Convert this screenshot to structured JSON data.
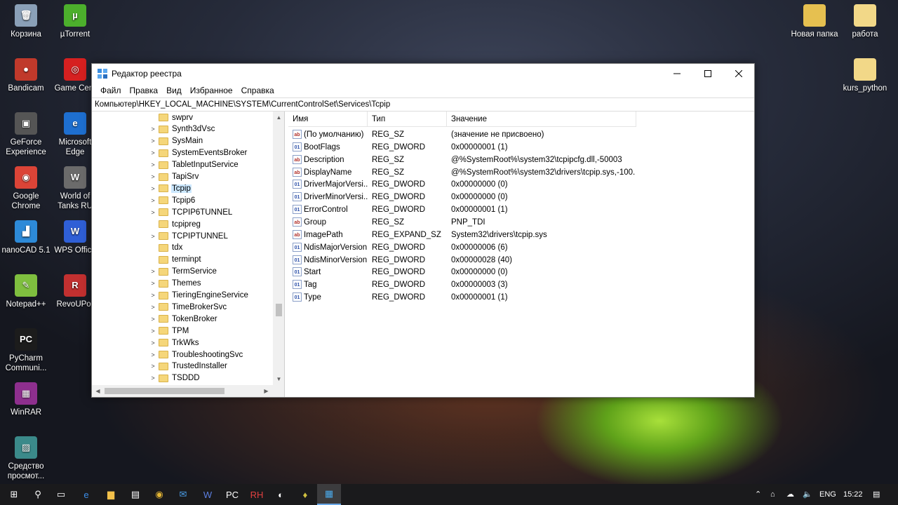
{
  "desktop_left": [
    {
      "label": "Корзина",
      "icon": "recycle-bin-icon",
      "color": "#8aa0b8",
      "glyph": "🗑"
    },
    {
      "label": "µTorrent",
      "icon": "utorrent-icon",
      "color": "#4caf2c",
      "glyph": "µ"
    },
    {
      "label": "Bandicam",
      "icon": "bandicam-icon",
      "color": "#c0392b",
      "glyph": "●"
    },
    {
      "label": "Game Cent",
      "icon": "game-center-icon",
      "color": "#d62020",
      "glyph": "◎"
    },
    {
      "label": "GeForce Experience",
      "icon": "geforce-icon",
      "color": "#555555",
      "glyph": "▣"
    },
    {
      "label": "Microsoft Edge",
      "icon": "edge-icon",
      "color": "#1e6fd0",
      "glyph": "e"
    },
    {
      "label": "Google Chrome",
      "icon": "chrome-icon",
      "color": "#db4437",
      "glyph": "◉"
    },
    {
      "label": "World of Tanks RU",
      "icon": "wot-icon",
      "color": "#6b6b6b",
      "glyph": "W"
    },
    {
      "label": "nanoCAD 5.1",
      "icon": "nanocad-icon",
      "color": "#2d8ad8",
      "glyph": "▟"
    },
    {
      "label": "WPS Office",
      "icon": "wps-icon",
      "color": "#2f5fd6",
      "glyph": "W"
    },
    {
      "label": "Notepad++",
      "icon": "notepadpp-icon",
      "color": "#7fbf3f",
      "glyph": "✎"
    },
    {
      "label": "RevoUPor",
      "icon": "revo-icon",
      "color": "#c23030",
      "glyph": "R"
    },
    {
      "label": "PyCharm Communi...",
      "icon": "pycharm-icon",
      "color": "#1c1c1c",
      "glyph": "PC"
    },
    {
      "label": "WinRAR",
      "icon": "winrar-icon",
      "color": "#8e2f8e",
      "glyph": "▦"
    },
    {
      "label": "Средство просмот...",
      "icon": "image-viewer-icon",
      "color": "#3b8a8a",
      "glyph": "▨"
    }
  ],
  "desktop_right": [
    {
      "label": "Новая папка",
      "icon": "folder-icon",
      "color": "#e6c050",
      "glyph": "▇"
    },
    {
      "label": "работа",
      "icon": "folder-icon",
      "color": "#f2d888",
      "glyph": "▇"
    },
    {
      "label": "kurs_python",
      "icon": "folder-icon",
      "color": "#f2d888",
      "glyph": "▇"
    }
  ],
  "window": {
    "title": "Редактор реестра",
    "menu": [
      "Файл",
      "Правка",
      "Вид",
      "Избранное",
      "Справка"
    ],
    "address": "Компьютер\\HKEY_LOCAL_MACHINE\\SYSTEM\\CurrentControlSet\\Services\\Tcpip"
  },
  "tree": [
    {
      "label": "swprv",
      "chev": ""
    },
    {
      "label": "Synth3dVsc",
      "chev": ">"
    },
    {
      "label": "SysMain",
      "chev": ">"
    },
    {
      "label": "SystemEventsBroker",
      "chev": ">"
    },
    {
      "label": "TabletInputService",
      "chev": ">"
    },
    {
      "label": "TapiSrv",
      "chev": ">"
    },
    {
      "label": "Tcpip",
      "chev": ">",
      "selected": true
    },
    {
      "label": "Tcpip6",
      "chev": ">"
    },
    {
      "label": "TCPIP6TUNNEL",
      "chev": ">"
    },
    {
      "label": "tcpipreg",
      "chev": ""
    },
    {
      "label": "TCPIPTUNNEL",
      "chev": ">"
    },
    {
      "label": "tdx",
      "chev": ""
    },
    {
      "label": "terminpt",
      "chev": ""
    },
    {
      "label": "TermService",
      "chev": ">"
    },
    {
      "label": "Themes",
      "chev": ">"
    },
    {
      "label": "TieringEngineService",
      "chev": ">"
    },
    {
      "label": "TimeBrokerSvc",
      "chev": ">"
    },
    {
      "label": "TokenBroker",
      "chev": ">"
    },
    {
      "label": "TPM",
      "chev": ">"
    },
    {
      "label": "TrkWks",
      "chev": ">"
    },
    {
      "label": "TroubleshootingSvc",
      "chev": ">"
    },
    {
      "label": "TrustedInstaller",
      "chev": ">"
    },
    {
      "label": "TSDDD",
      "chev": ">"
    }
  ],
  "columns": [
    "Имя",
    "Тип",
    "Значение"
  ],
  "values": [
    {
      "name": "(По умолчанию)",
      "type": "REG_SZ",
      "value": "(значение не присвоено)",
      "kind": "ab"
    },
    {
      "name": "BootFlags",
      "type": "REG_DWORD",
      "value": "0x00000001 (1)",
      "kind": "dw"
    },
    {
      "name": "Description",
      "type": "REG_SZ",
      "value": "@%SystemRoot%\\system32\\tcpipcfg.dll,-50003",
      "kind": "ab"
    },
    {
      "name": "DisplayName",
      "type": "REG_SZ",
      "value": "@%SystemRoot%\\system32\\drivers\\tcpip.sys,-100...",
      "kind": "ab"
    },
    {
      "name": "DriverMajorVersi...",
      "type": "REG_DWORD",
      "value": "0x00000000 (0)",
      "kind": "dw"
    },
    {
      "name": "DriverMinorVersi...",
      "type": "REG_DWORD",
      "value": "0x00000000 (0)",
      "kind": "dw"
    },
    {
      "name": "ErrorControl",
      "type": "REG_DWORD",
      "value": "0x00000001 (1)",
      "kind": "dw"
    },
    {
      "name": "Group",
      "type": "REG_SZ",
      "value": "PNP_TDI",
      "kind": "ab"
    },
    {
      "name": "ImagePath",
      "type": "REG_EXPAND_SZ",
      "value": "System32\\drivers\\tcpip.sys",
      "kind": "ab"
    },
    {
      "name": "NdisMajorVersion",
      "type": "REG_DWORD",
      "value": "0x00000006 (6)",
      "kind": "dw"
    },
    {
      "name": "NdisMinorVersion",
      "type": "REG_DWORD",
      "value": "0x00000028 (40)",
      "kind": "dw"
    },
    {
      "name": "Start",
      "type": "REG_DWORD",
      "value": "0x00000000 (0)",
      "kind": "dw"
    },
    {
      "name": "Tag",
      "type": "REG_DWORD",
      "value": "0x00000003 (3)",
      "kind": "dw"
    },
    {
      "name": "Type",
      "type": "REG_DWORD",
      "value": "0x00000001 (1)",
      "kind": "dw"
    }
  ],
  "taskbar": {
    "apps": [
      {
        "name": "start-button",
        "glyph": "⊞",
        "color": "#ffffff"
      },
      {
        "name": "search-icon",
        "glyph": "⚲",
        "color": "#ffffff"
      },
      {
        "name": "task-view-icon",
        "glyph": "▭",
        "color": "#ffffff"
      },
      {
        "name": "edge-taskbar-icon",
        "glyph": "e",
        "color": "#3c8ee8"
      },
      {
        "name": "explorer-taskbar-icon",
        "glyph": "▆",
        "color": "#f2c04a"
      },
      {
        "name": "store-taskbar-icon",
        "glyph": "▤",
        "color": "#ffffff"
      },
      {
        "name": "chrome-taskbar-icon",
        "glyph": "◉",
        "color": "#e4b534"
      },
      {
        "name": "mail-taskbar-icon",
        "glyph": "✉",
        "color": "#4a9ee8"
      },
      {
        "name": "wps-taskbar-icon",
        "glyph": "W",
        "color": "#5c7fe0"
      },
      {
        "name": "pycharm-taskbar-icon",
        "glyph": "PC",
        "color": "#ffffff"
      },
      {
        "name": "rh-taskbar-icon",
        "glyph": "RH",
        "color": "#e04040"
      },
      {
        "name": "steam-taskbar-icon",
        "glyph": "◐",
        "color": "#ffffff"
      },
      {
        "name": "app-taskbar-icon",
        "glyph": "♦",
        "color": "#d0c040"
      },
      {
        "name": "regedit-taskbar-icon",
        "glyph": "▦",
        "color": "#4aa8e8",
        "active": true
      }
    ],
    "lang": "ENG",
    "time": "15:22"
  }
}
